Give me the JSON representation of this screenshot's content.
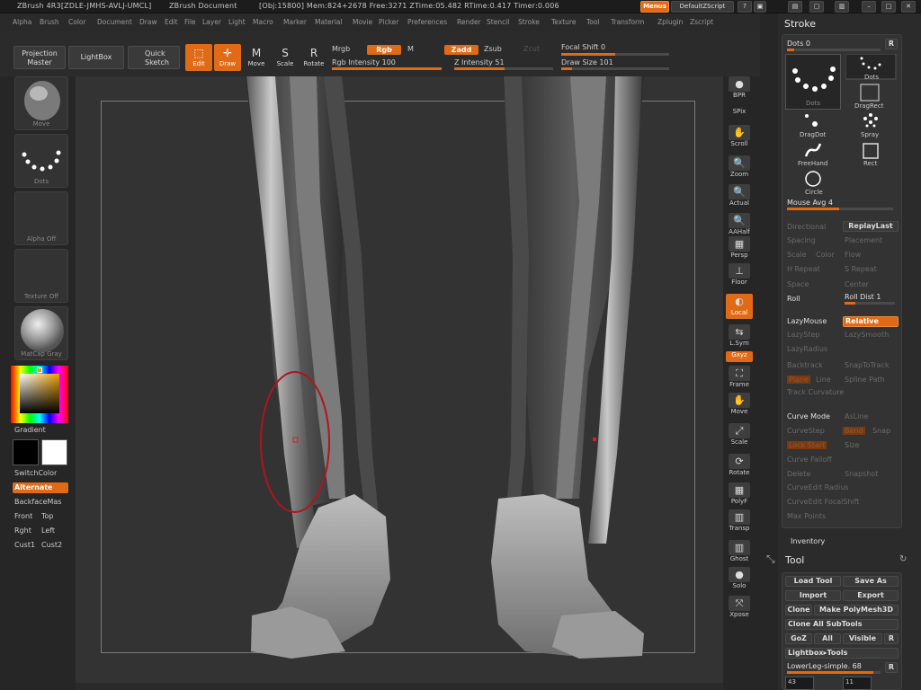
{
  "titlebar": {
    "app": "ZBrush 4R3[ZDLE-JMHS-AVLJ-UMCL]",
    "doc": "ZBrush Document",
    "stats": "[Obj:15800] Mem:824+2678 Free:3271 ZTime:05.482 RTime:0.417 Timer:0.006",
    "menus_btn": "Menus",
    "script_btn": "DefaultZScript"
  },
  "menubar": [
    "Alpha",
    "Brush",
    "Color",
    "Document",
    "Draw",
    "Edit",
    "File",
    "Layer",
    "Light",
    "Macro",
    "Marker",
    "Material",
    "Movie",
    "Picker",
    "Preferences",
    "Render",
    "Stencil",
    "Stroke",
    "Texture",
    "Tool",
    "Transform",
    "Zplugin",
    "Zscript"
  ],
  "toolbar": {
    "projection_master": "Projection Master",
    "lightbox": "LightBox",
    "quick_sketch": "Quick Sketch",
    "edit": "Edit",
    "draw": "Draw",
    "move": "Move",
    "scale": "Scale",
    "rotate": "Rotate",
    "mrgb": "Mrgb",
    "rgb": "Rgb",
    "m": "M",
    "rgb_intensity_label": "Rgb Intensity",
    "rgb_intensity": "100",
    "rgb_intensity_level": 1.0,
    "zadd": "Zadd",
    "zsub": "Zsub",
    "zcut": "Zcut",
    "z_intensity_label": "Z Intensity",
    "z_intensity": "51",
    "z_intensity_level": 0.51,
    "focal_shift_label": "Focal Shift",
    "focal_shift": "0",
    "focal_shift_level": 0.5,
    "draw_size_label": "Draw Size",
    "draw_size": "101",
    "draw_size_level": 0.1
  },
  "leftshelf": {
    "brush_caption": "Move",
    "stroke_caption": "Dots",
    "alpha_caption": "Alpha Off",
    "texture_caption": "Texture Off",
    "material_caption": "MatCap Gray",
    "gradient": "Gradient",
    "switchcolor": "SwitchColor",
    "alternate": "Alternate",
    "backface": "BackfaceMas",
    "front": "Front",
    "top": "Top",
    "right": "Rght",
    "left": "Left",
    "cust1": "Cust1",
    "cust2": "Cust2"
  },
  "rightshelf": [
    "BPR",
    "SPix",
    "Scroll",
    "Zoom",
    "Actual",
    "AAHalf",
    "Persp",
    "Floor",
    "Local",
    "L.Sym",
    "Gxyz",
    "Frame",
    "Move",
    "Scale",
    "Rotate",
    "PolyF",
    "Transp",
    "Ghost",
    "Solo",
    "Xpose"
  ],
  "stroke_panel": {
    "title": "Stroke",
    "dots_label": "Dots",
    "dots_value": "0",
    "r": "R",
    "types": [
      "Dots",
      "Dots",
      "DragRect",
      "DragDot",
      "Spray",
      "FreeHand",
      "Rect",
      "Circle"
    ],
    "mouse_avg_label": "Mouse Avg",
    "mouse_avg": "4",
    "directional": "Directional",
    "replaylast": "ReplayLast",
    "spacing": "Spacing",
    "placement": "Placement",
    "scale": "Scale",
    "color": "Color",
    "flow": "Flow",
    "h_repeat": "H Repeat",
    "s_repeat": "S Repeat",
    "space": "Space",
    "center": "Center",
    "roll": "Roll",
    "roll_dist_label": "Roll Dist",
    "roll_dist": "1",
    "lazymouse": "LazyMouse",
    "relative": "Relative",
    "lazystep": "LazyStep",
    "lazysmooth": "LazySmooth",
    "lazyradius": "LazyRadius",
    "backtrack": "Backtrack",
    "snaptotrack": "SnapToTrack",
    "plane": "Plane",
    "line": "Line",
    "spline_path": "Spline Path",
    "track_curvature": "Track Curvature",
    "curve_mode": "Curve Mode",
    "asline": "AsLine",
    "curvestep": "CurveStep",
    "bend": "Bend",
    "snap": "Snap",
    "lock_start": "Lock Start",
    "size": "Size",
    "curve_falloff": "Curve Falloff",
    "delete": "Delete",
    "snapshot": "Snapshot",
    "curveedit_radius": "CurveEdit Radius",
    "curveedit_focalshift": "CurveEdit FocalShift",
    "max_points": "Max Points"
  },
  "inventory": "Inventory",
  "tool_panel": {
    "title": "Tool",
    "load_tool": "Load Tool",
    "save_as": "Save As",
    "import": "Import",
    "export": "Export",
    "clone": "Clone",
    "make_polymesh": "Make PolyMesh3D",
    "clone_all": "Clone All SubTools",
    "goz": "GoZ",
    "all": "All",
    "visible": "Visible",
    "r": "R",
    "lightbox_tools": "Lightbox▸Tools",
    "current_tool": "LowerLeg-simple. 68",
    "thumb_a": "43",
    "thumb_b": "11"
  },
  "colors": {
    "accent": "#e06a16",
    "bg": "#262626",
    "canvas": "#333333",
    "brush_circle": "#b0141e"
  }
}
